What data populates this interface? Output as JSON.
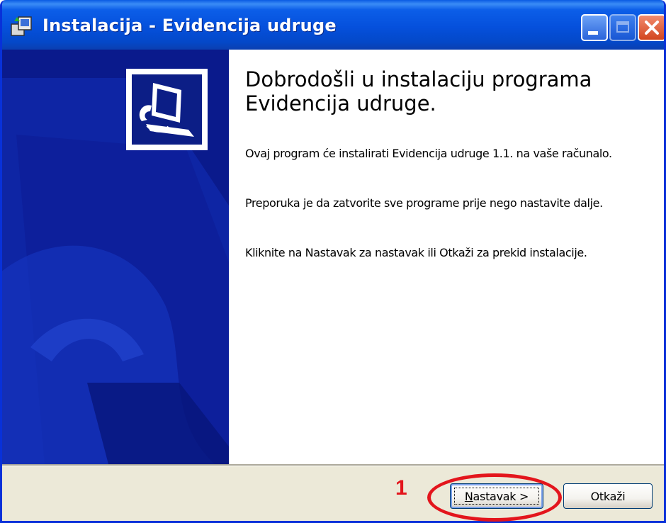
{
  "window": {
    "title": "Instalacija - Evidencija udruge",
    "icon": "installer-icon"
  },
  "titlebar_buttons": [
    "minimize-icon",
    "maximize-icon",
    "close-icon"
  ],
  "main": {
    "heading": "Dobrodošli u instalaciju programa Evidencija udruge.",
    "paragraphs": [
      "Ovaj program će instalirati Evidencija udruge 1.1. na vaše računalo.",
      "Preporuka je da zatvorite sve programe prije nego nastavite dalje.",
      "Kliknite na Nastavak za nastavak ili Otkaži za prekid instalacije."
    ]
  },
  "footer": {
    "next_label_mnemonic": "N",
    "next_label_rest": "astavak >",
    "cancel_label": "Otkaži"
  },
  "annotation": {
    "number": "1",
    "color": "#e3151c"
  },
  "colors": {
    "titlebar": "#0550dc",
    "side_panel": "#0a1a8c",
    "dialog_bg": "#ece9d8"
  }
}
